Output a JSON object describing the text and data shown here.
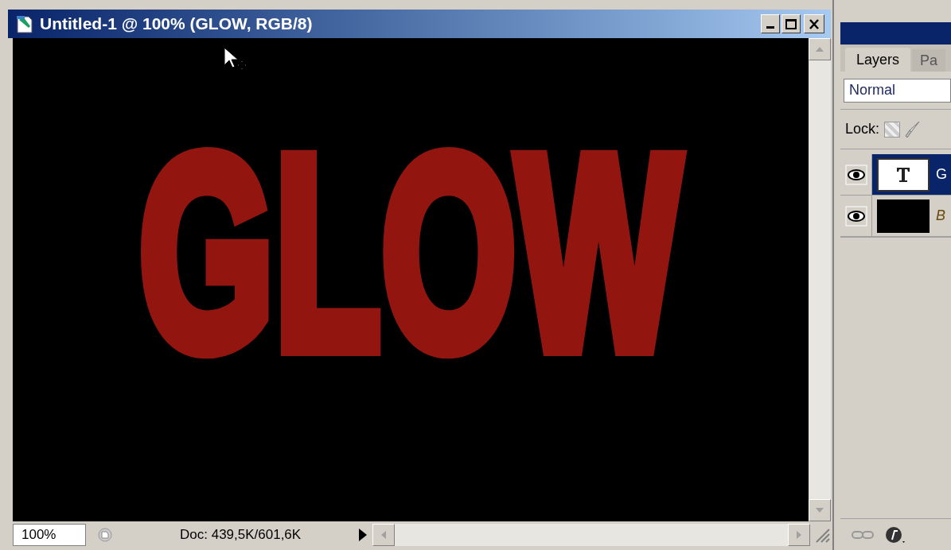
{
  "document_window": {
    "title": "Untitled-1 @ 100% (GLOW, RGB/8)",
    "canvas_text": "GLOW",
    "zoom_field": "100%",
    "doc_info": "Doc: 439,5K/601,6K"
  },
  "layers_panel": {
    "tabs": [
      {
        "label": "Layers",
        "selected": true
      },
      {
        "label": "Pa",
        "selected": false
      }
    ],
    "blend_mode": "Normal",
    "lock_label": "Lock:",
    "layers": [
      {
        "kind": "text",
        "name": "G",
        "selected": true,
        "visible": true
      },
      {
        "kind": "fill",
        "name": "B",
        "selected": false,
        "visible": true
      }
    ]
  }
}
